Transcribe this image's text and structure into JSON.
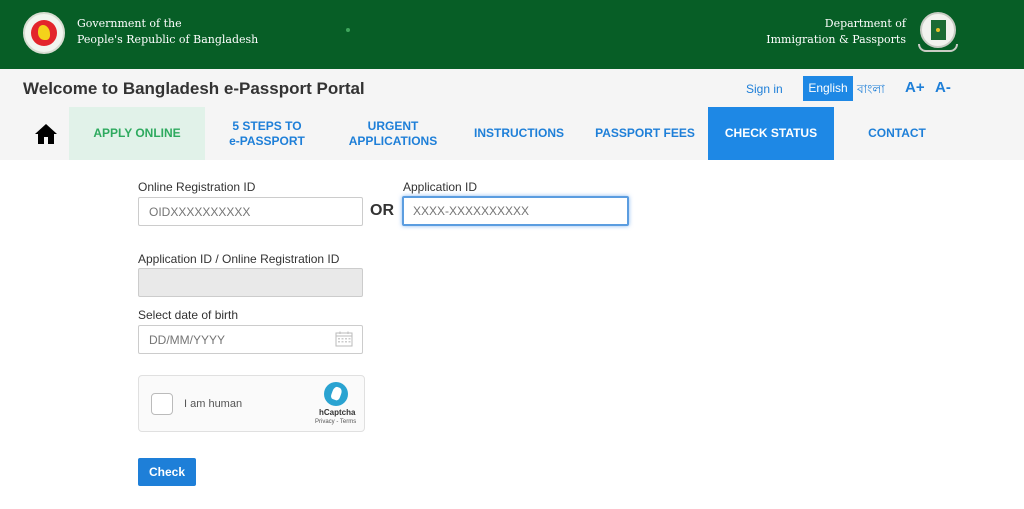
{
  "header": {
    "gov_line1": "Government of the",
    "gov_line2": "People's Republic of Bangladesh",
    "dept_line1": "Department of",
    "dept_line2": "Immigration & Passports"
  },
  "subheader": {
    "portal_title": "Welcome to Bangladesh e-Passport Portal",
    "sign_in": "Sign in",
    "lang_english": "English",
    "lang_bangla": "বাংলা",
    "font_increase": "A+",
    "font_decrease": "A-"
  },
  "nav": {
    "home_icon": "home-icon",
    "items": [
      {
        "line1": "APPLY ONLINE",
        "line2": ""
      },
      {
        "line1": "5 STEPS TO",
        "line2": "e-PASSPORT"
      },
      {
        "line1": "URGENT",
        "line2": "APPLICATIONS"
      },
      {
        "line1": "INSTRUCTIONS",
        "line2": ""
      },
      {
        "line1": "PASSPORT FEES",
        "line2": ""
      },
      {
        "line1": "CHECK STATUS",
        "line2": ""
      },
      {
        "line1": "CONTACT",
        "line2": ""
      }
    ],
    "active": "CHECK STATUS"
  },
  "form": {
    "online_reg_label": "Online Registration ID",
    "online_reg_placeholder": "OIDXXXXXXXXXX",
    "online_reg_value": "",
    "or_text": "OR",
    "app_id_label": "Application ID",
    "app_id_placeholder": "XXXX-XXXXXXXXXX",
    "app_id_value": "",
    "combined_label": "Application ID / Online Registration ID",
    "combined_value": "",
    "dob_label": "Select date of birth",
    "dob_placeholder": "DD/MM/YYYY",
    "dob_value": "",
    "captcha_label": "I am human",
    "captcha_brand": "hCaptcha",
    "captcha_links": "Privacy - Terms",
    "submit_label": "Check"
  },
  "colors": {
    "header_green": "#075e26",
    "accent_blue": "#1e88e5",
    "apply_green": "#2eaa5f"
  }
}
